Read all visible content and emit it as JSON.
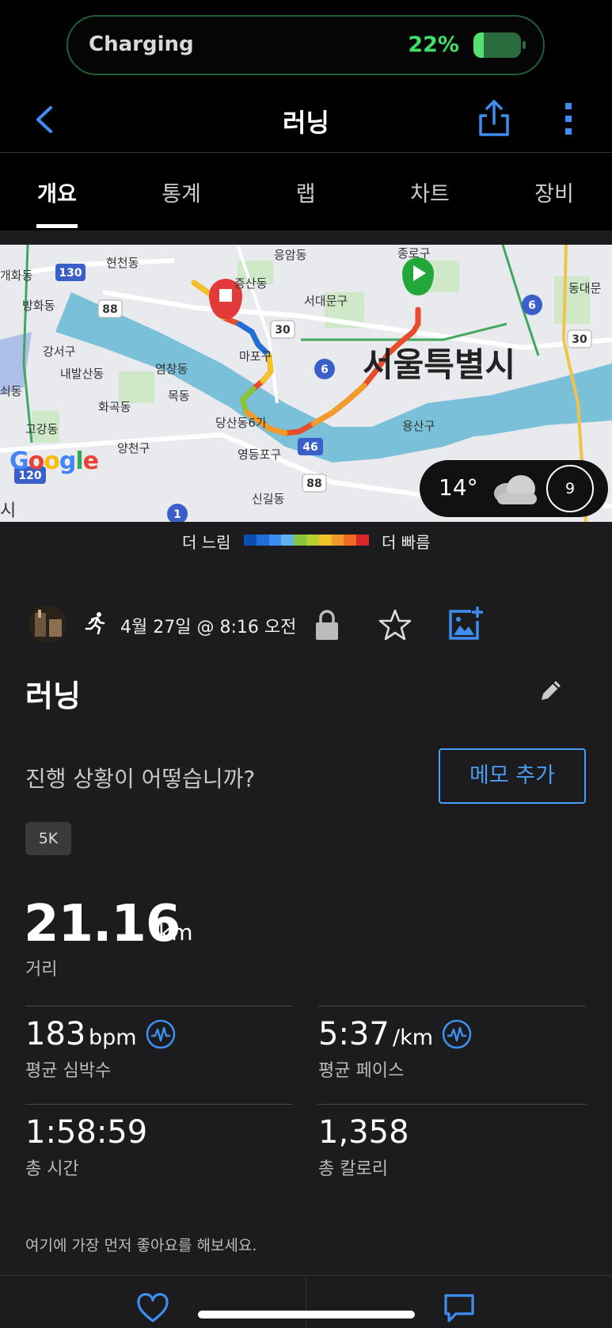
{
  "status": {
    "charging_label": "Charging",
    "battery_percent": "22%",
    "battery_level": 0.22
  },
  "nav": {
    "title": "러닝"
  },
  "tabs": [
    {
      "label": "개요",
      "active": true
    },
    {
      "label": "통계"
    },
    {
      "label": "랩"
    },
    {
      "label": "차트"
    },
    {
      "label": "장비"
    }
  ],
  "map": {
    "labels": [
      "응암동",
      "종로구",
      "현천동",
      "개화동",
      "증산동",
      "서대문구",
      "동대문",
      "방화동",
      "강서구",
      "마포구",
      "내발산동",
      "염창동",
      "화곡동",
      "목동",
      "고강동",
      "양천구",
      "당산동6가",
      "영등포구",
      "용산구",
      "신길동",
      "서울특별시",
      "쇠동",
      "시"
    ],
    "road_badges": [
      "130",
      "88",
      "30",
      "6",
      "6",
      "30",
      "46",
      "120",
      "88",
      "1"
    ],
    "google": "Google",
    "weather": {
      "temp": "14°",
      "wind": "9"
    }
  },
  "speed_legend": {
    "slow": "더 느림",
    "fast": "더 빠름",
    "colors": [
      "#0a4fb0",
      "#1f6fd6",
      "#3b8ff0",
      "#5fb0f0",
      "#88c43c",
      "#b6cf2c",
      "#f2c22a",
      "#f29a2a",
      "#ee6a24",
      "#d9262a"
    ]
  },
  "meta": {
    "date": "4월 27일 @ 8:16 오전"
  },
  "activity": {
    "title": "러닝"
  },
  "prompt": {
    "text": "진행 상황이 어떻습니까?",
    "memo_button": "메모 추가"
  },
  "tag": "5K",
  "distance": {
    "value": "21.16",
    "unit": "km",
    "label": "거리"
  },
  "stats": {
    "hr": {
      "value": "183",
      "unit": "bpm",
      "label": "평균 심박수"
    },
    "pace": {
      "value": "5:37",
      "unit": "/km",
      "label": "평균 페이스"
    },
    "time": {
      "value": "1:58:59",
      "label": "총 시간"
    },
    "calories": {
      "value": "1,358",
      "label": "총 칼로리"
    }
  },
  "like_prompt": "여기에 가장 먼저 좋아요를 해보세요."
}
